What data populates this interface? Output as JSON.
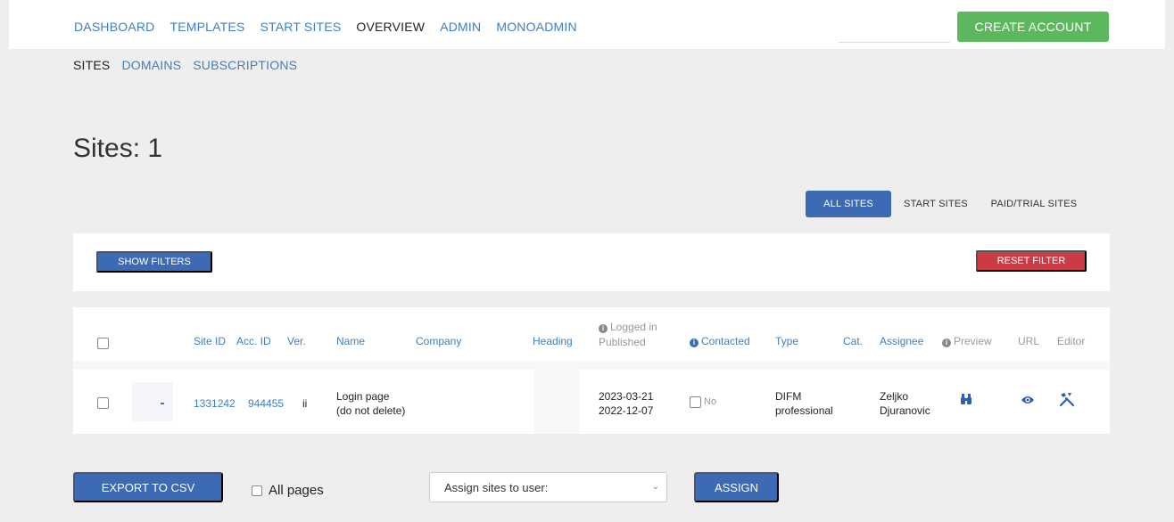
{
  "topnav": {
    "items": [
      {
        "label": "DASHBOARD",
        "active": false
      },
      {
        "label": "TEMPLATES",
        "active": false
      },
      {
        "label": "START SITES",
        "active": false
      },
      {
        "label": "OVERVIEW",
        "active": true
      },
      {
        "label": "ADMIN",
        "active": false
      },
      {
        "label": "MONOADMIN",
        "active": false
      }
    ],
    "create_account": "CREATE ACCOUNT"
  },
  "subnav": {
    "items": [
      {
        "label": "SITES",
        "active": true
      },
      {
        "label": "DOMAINS",
        "active": false
      },
      {
        "label": "SUBSCRIPTIONS",
        "active": false
      }
    ]
  },
  "page_title": "Sites: 1",
  "segments": {
    "all": "ALL SITES",
    "start": "START SITES",
    "paid": "PAID/TRIAL SITES",
    "selected": "ALL SITES"
  },
  "filters": {
    "show": "SHOW FILTERS",
    "reset": "RESET FILTER"
  },
  "table": {
    "headers": {
      "site_id": "Site ID",
      "acc_id": "Acc. ID",
      "ver": "Ver.",
      "name": "Name",
      "company": "Company",
      "heading": "Heading",
      "logged_in": "Logged in",
      "published": "Published",
      "contacted": "Contacted",
      "type": "Type",
      "cat": "Cat.",
      "assignee": "Assignee",
      "preview": "Preview",
      "url": "URL",
      "editor": "Editor"
    },
    "rows": [
      {
        "site_id": "1331242",
        "acc_id": "944455",
        "ver": "ii",
        "name_line1": "Login page",
        "name_line2": "(do not delete)",
        "company": "",
        "heading": "",
        "logged_in": "2023-03-21",
        "published": "2022-12-07",
        "contacted": "No",
        "type_line1": "DIFM",
        "type_line2": "professional",
        "cat": "",
        "assignee_line1": "Zeljko",
        "assignee_line2": "Djuranovic"
      }
    ]
  },
  "icons": {
    "preview": "binoculars-icon",
    "url": "eye-icon",
    "editor": "tools-icon",
    "info": "info-icon"
  },
  "footer": {
    "export": "EXPORT TO CSV",
    "all_pages": "All pages",
    "assign_placeholder": "Assign sites to user:",
    "assign": "ASSIGN"
  },
  "colors": {
    "primary": "#3d6ab5",
    "link": "#3f7fc1",
    "success": "#5cb85c",
    "danger": "#cc3b44"
  }
}
